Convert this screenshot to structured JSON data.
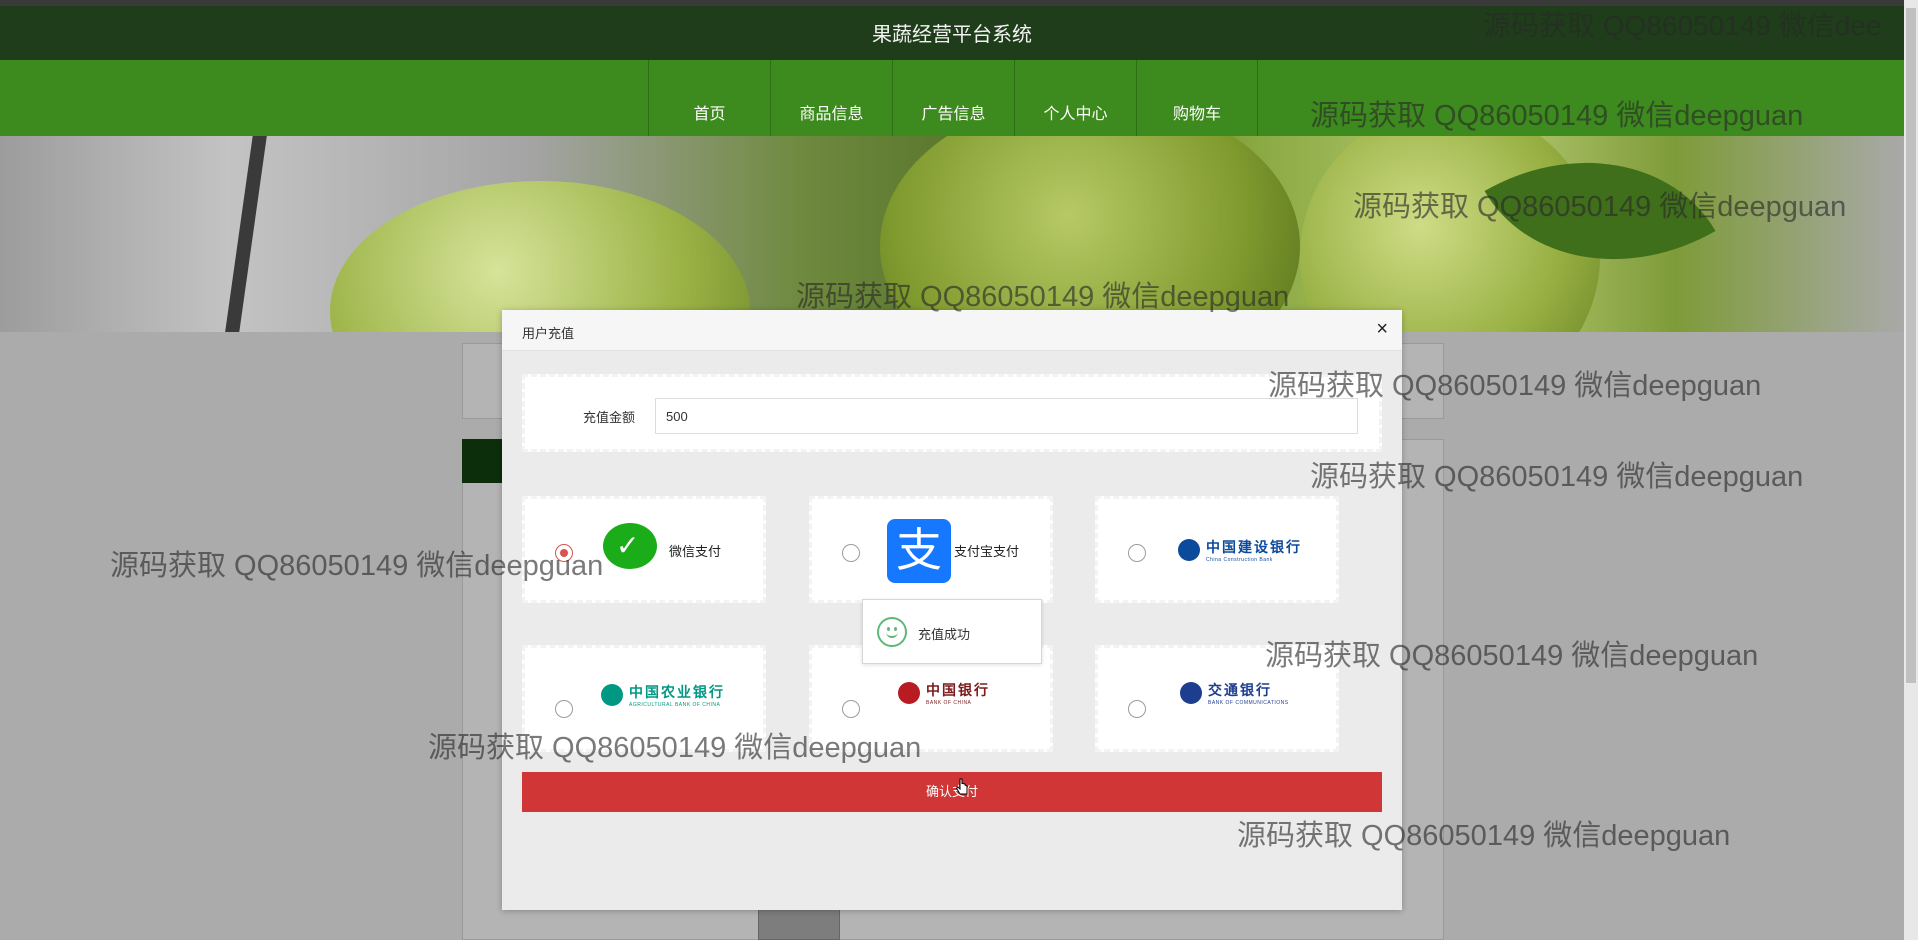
{
  "header": {
    "title": "果蔬经营平台系统"
  },
  "nav": {
    "items": [
      "首页",
      "商品信息",
      "广告信息",
      "个人中心",
      "购物车"
    ]
  },
  "modal": {
    "title": "用户充值",
    "close_symbol": "×",
    "amount_label": "充值金额",
    "amount_value": "500",
    "payment_methods": {
      "wechat": {
        "label": "微信支付",
        "selected": true
      },
      "alipay": {
        "label": "支付宝支付",
        "logo_char": "支",
        "selected": false
      },
      "ccb": {
        "name_cn": "中国建设银行",
        "name_en": "China Construction Bank",
        "selected": false
      },
      "abc": {
        "name_cn": "中国农业银行",
        "name_en": "AGRICULTURAL BANK OF CHINA",
        "selected": false
      },
      "boc": {
        "name_cn": "中国银行",
        "name_en": "BANK OF CHINA",
        "selected": false
      },
      "bocom": {
        "name_cn": "交通银行",
        "name_en": "BANK OF COMMUNICATIONS",
        "selected": false
      }
    },
    "toast_message": "充值成功",
    "confirm_label": "确认支付"
  },
  "watermark": {
    "text": "源码获取 QQ86050149 微信deepguan",
    "text_clipped": "源码获取 QQ86050149 微信dee"
  },
  "colors": {
    "topbar": "#1f3d1a",
    "nav": "#3d8a1e",
    "confirm": "#d13637",
    "wechat": "#1aad19",
    "alipay": "#1677ff",
    "ccb": "#0c4a9c",
    "abc": "#009882",
    "boc": "#b81c22",
    "bocom": "#1d3d8f"
  }
}
